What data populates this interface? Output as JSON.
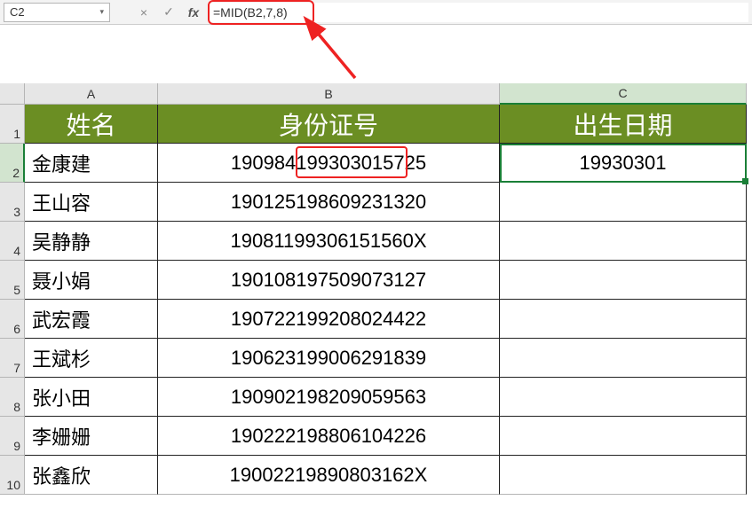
{
  "namebox": {
    "value": "C2"
  },
  "formula_bar": {
    "cancel_icon": "×",
    "confirm_icon": "✓",
    "fx_label": "fx",
    "formula": "=MID(B2,7,8)"
  },
  "columns": {
    "A": "A",
    "B": "B",
    "C": "C"
  },
  "row_numbers": [
    "1",
    "2",
    "3",
    "4",
    "5",
    "6",
    "7",
    "8",
    "9",
    "10"
  ],
  "headers": {
    "A": "姓名",
    "B": "身份证号",
    "C": "出生日期"
  },
  "rows": [
    {
      "name": "金康建",
      "id": "190984199303015725",
      "dob": "19930301"
    },
    {
      "name": "王山容",
      "id": "190125198609231320",
      "dob": ""
    },
    {
      "name": "吴静静",
      "id": "19081199306151560X",
      "dob": ""
    },
    {
      "name": "聂小娟",
      "id": "190108197509073127",
      "dob": ""
    },
    {
      "name": "武宏霞",
      "id": "190722199208024422",
      "dob": ""
    },
    {
      "name": "王斌杉",
      "id": "190623199006291839",
      "dob": ""
    },
    {
      "name": "张小田",
      "id": "190902198209059563",
      "dob": ""
    },
    {
      "name": "李姗姗",
      "id": "190222198806104226",
      "dob": ""
    },
    {
      "name": "张鑫欣",
      "id": "19002219890803162X",
      "dob": ""
    }
  ],
  "highlight": {
    "b2_substring": "19930301"
  },
  "colors": {
    "header_bg": "#6b8e23",
    "selection": "#1a7f37",
    "annotation": "#e22"
  },
  "chart_data": {
    "type": "table",
    "title": "",
    "columns": [
      "姓名",
      "身份证号",
      "出生日期"
    ],
    "rows": [
      [
        "金康建",
        "190984199303015725",
        "19930301"
      ],
      [
        "王山容",
        "190125198609231320",
        ""
      ],
      [
        "吴静静",
        "19081199306151560X",
        ""
      ],
      [
        "聂小娟",
        "190108197509073127",
        ""
      ],
      [
        "武宏霞",
        "190722199208024422",
        ""
      ],
      [
        "王斌杉",
        "190623199006291839",
        ""
      ],
      [
        "张小田",
        "190902198209059563",
        ""
      ],
      [
        "李姗姗",
        "190222198806104226",
        ""
      ],
      [
        "张鑫欣",
        "19002219890803162X",
        ""
      ]
    ]
  }
}
